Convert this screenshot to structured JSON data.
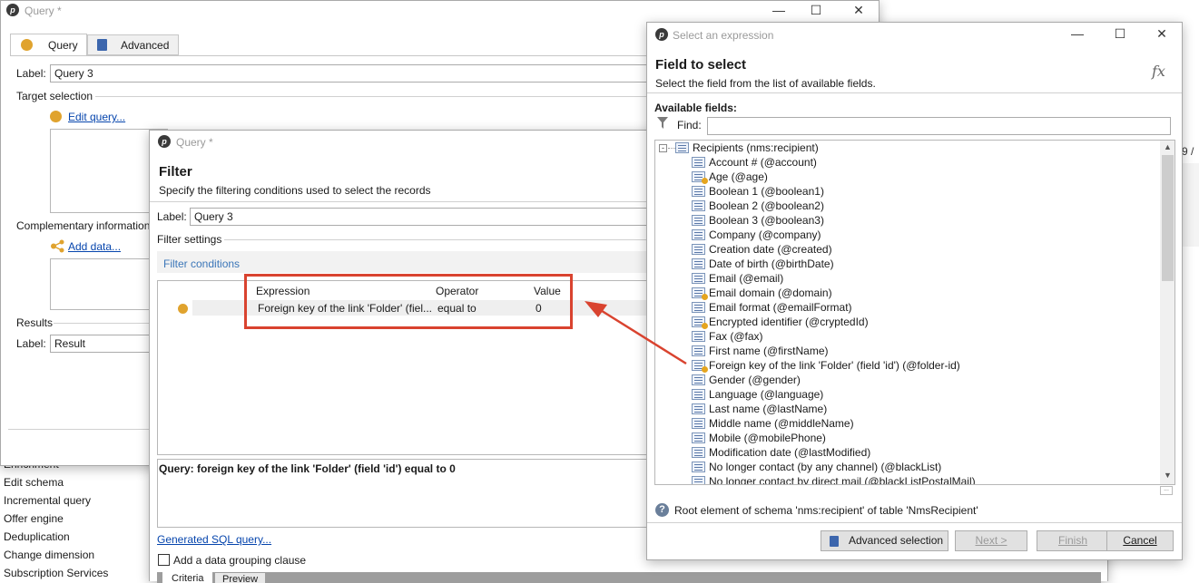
{
  "query_window": {
    "title": "Query *",
    "tabs": [
      {
        "label": "Query"
      },
      {
        "label": "Advanced"
      }
    ],
    "label_caption": "Label:",
    "label_value": "Query 3",
    "target_selection": "Target selection",
    "edit_query": "Edit query...",
    "complementary_information": "Complementary information",
    "add_data": "Add data...",
    "results": "Results",
    "results_label_caption": "Label:",
    "results_label_value": "Result"
  },
  "left_panel_items": [
    "Enrichment",
    "Edit schema",
    "Incremental query",
    "Offer engine",
    "Deduplication",
    "Change dimension",
    "Subscription Services"
  ],
  "filter_window": {
    "title": "Query *",
    "heading": "Filter",
    "subheading": "Specify the filtering conditions used to select the records",
    "label_caption": "Label:",
    "label_value": "Query 3",
    "filter_settings": "Filter settings",
    "filter_conditions": "Filter conditions",
    "table": {
      "columns": [
        "Expression",
        "Operator",
        "Value"
      ],
      "rows": [
        {
          "expression": "Foreign key of the link 'Folder' (fiel...",
          "operator": "equal to",
          "value": "0"
        }
      ]
    },
    "query_text": "Query: foreign key of the link 'Folder' (field 'id') equal to 0",
    "generated_sql": "Generated SQL query...",
    "group_clause": "Add a data grouping clause",
    "bottom_tabs": [
      "Criteria",
      "Preview"
    ]
  },
  "select_window": {
    "title": "Select an expression",
    "heading": "Field to select",
    "subheading": "Select the field from the list of available fields.",
    "fx": "fx",
    "available_fields": "Available fields:",
    "find_label": "Find:",
    "root": "Recipients (nms:recipient)",
    "fields": [
      {
        "label": "Account # (@account)",
        "key": false
      },
      {
        "label": "Age (@age)",
        "key": true
      },
      {
        "label": "Boolean 1 (@boolean1)",
        "key": false
      },
      {
        "label": "Boolean 2 (@boolean2)",
        "key": false
      },
      {
        "label": "Boolean 3 (@boolean3)",
        "key": false
      },
      {
        "label": "Company (@company)",
        "key": false
      },
      {
        "label": "Creation date (@created)",
        "key": false
      },
      {
        "label": "Date of birth (@birthDate)",
        "key": false
      },
      {
        "label": "Email (@email)",
        "key": false
      },
      {
        "label": "Email domain (@domain)",
        "key": true
      },
      {
        "label": "Email format (@emailFormat)",
        "key": false
      },
      {
        "label": "Encrypted identifier (@cryptedId)",
        "key": true
      },
      {
        "label": "Fax (@fax)",
        "key": false
      },
      {
        "label": "First name (@firstName)",
        "key": false
      },
      {
        "label": "Foreign key of the link 'Folder' (field 'id') (@folder-id)",
        "key": true,
        "selected": true
      },
      {
        "label": "Gender (@gender)",
        "key": false
      },
      {
        "label": "Language (@language)",
        "key": false
      },
      {
        "label": "Last name (@lastName)",
        "key": false
      },
      {
        "label": "Middle name (@middleName)",
        "key": false
      },
      {
        "label": "Mobile (@mobilePhone)",
        "key": false
      },
      {
        "label": "Modification date (@lastModified)",
        "key": false
      },
      {
        "label": "No longer contact (by any channel) (@blackList)",
        "key": false
      },
      {
        "label": "No longer contact by direct mail (@blackListPostalMail)",
        "key": false
      }
    ],
    "status": "Root element of schema 'nms:recipient' of table 'NmsRecipient'",
    "buttons": {
      "advanced": "Advanced selection",
      "next": "Next >",
      "finish": "Finish",
      "cancel": "Cancel"
    }
  },
  "background_fragment": "9 /",
  "colors": {
    "annotation_red": "#d9432f",
    "accent_orange": "#e0a32e",
    "link_blue": "#0645ad"
  }
}
